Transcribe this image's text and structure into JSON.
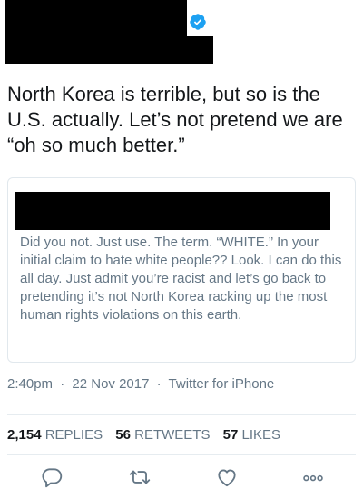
{
  "tweet": {
    "text": "North Korea is terrible, but so is the U.S. actually. Let’s not pretend we are “oh so much better.”"
  },
  "quoted_tweet": {
    "text": "Did you not. Just use. The term. “WHITE.” In your initial claim to hate white people?? Look. I can do this all day. Just admit you’re racist and let’s go back to pretending it’s not North Korea racking up the most human rights violations on this earth."
  },
  "meta": {
    "time": "2:40pm",
    "separator": "·",
    "date": "22 Nov 2017",
    "source": "Twitter for iPhone"
  },
  "stats": {
    "replies_count": "2,154",
    "replies_label": "REPLIES",
    "retweets_count": "56",
    "retweets_label": "RETWEETS",
    "likes_count": "57",
    "likes_label": "LIKES"
  },
  "icons": {
    "verified": "verified-badge-icon",
    "reply": "reply-icon",
    "retweet": "retweet-icon",
    "like": "heart-icon",
    "more": "more-icon"
  },
  "colors": {
    "verified": "#1da1f2",
    "muted": "#657786",
    "text": "#14171a",
    "border": "#e1e8ed"
  }
}
